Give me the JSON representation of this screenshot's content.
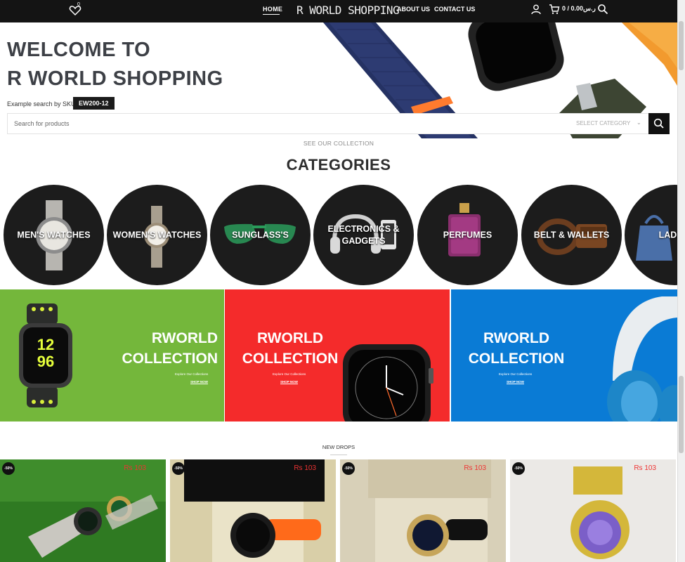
{
  "header": {
    "wishlist_count": "0",
    "nav": {
      "home": "HOME",
      "about": "ABOUT US",
      "contact": "CONTACT US"
    },
    "logo": "R WORLD SHOPPING",
    "cart_total": "0 / 0.00ر.س"
  },
  "hero": {
    "title_line1": "WELCOME TO",
    "title_line2": "R WORLD SHOPPING",
    "sku_label": "Example search by SKU:",
    "sku_value": "EW200-12",
    "search_placeholder": "Search for products",
    "category_select": "SELECT CATEGORY",
    "see_collection": "SEE OUR COLLECTION"
  },
  "categories": {
    "heading": "CATEGORIES",
    "items": [
      "MEN'S WATCHES",
      "WOMEN'S WATCHES",
      "SUNGLASS'S",
      "ELECTRONICS & GADGETS",
      "PERFUMES",
      "BELT & WALLETS",
      "LADIES"
    ]
  },
  "banners": [
    {
      "line1": "RWORLD",
      "line2": "COLLECTION",
      "sub": "Explore Our Collections",
      "link": "SHOP NOW",
      "color": "#74b73b"
    },
    {
      "line1": "RWORLD",
      "line2": "COLLECTION",
      "sub": "Explore Our Collections",
      "link": "SHOP NOW",
      "color": "#f42b2b"
    },
    {
      "line1": "RWORLD",
      "line2": "COLLECTION",
      "sub": "Explore Our Collections",
      "link": "SHOP NOW",
      "color": "#0a7bd5"
    }
  ],
  "new_drops": "NEW DROPS",
  "products": [
    {
      "discount": "-50%",
      "price": "Rs 103"
    },
    {
      "discount": "-50%",
      "price": "Rs 103"
    },
    {
      "discount": "-50%",
      "price": "Rs 103"
    },
    {
      "discount": "-50%",
      "price": "Rs 103"
    }
  ]
}
